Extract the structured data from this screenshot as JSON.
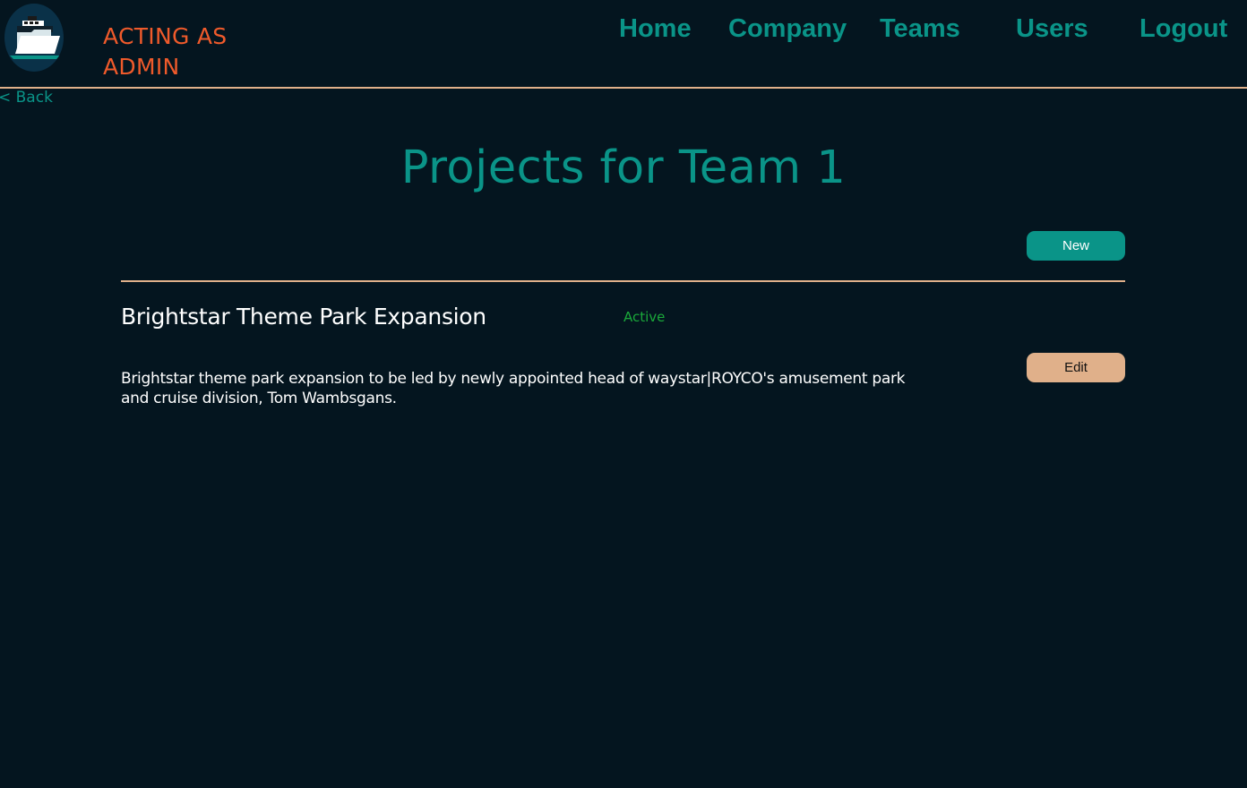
{
  "header": {
    "role_label": "ACTING AS ADMIN",
    "logo_icon": "folder-ship-logo-icon"
  },
  "nav": {
    "home": "Home",
    "company": "Company",
    "teams": "Teams",
    "users": "Users",
    "logout": "Logout"
  },
  "back_link": "< Back",
  "page_title": "Projects for Team 1",
  "new_button": "New",
  "projects": [
    {
      "name": "Brightstar Theme Park Expansion",
      "status": "Active",
      "description": "Brightstar theme park expansion to be led by newly appointed head of waystar|ROYCO's amusement park and cruise division, Tom Wambsgans.",
      "edit_label": "Edit"
    }
  ],
  "colors": {
    "background": "#04151f",
    "accent_teal": "#0a9488",
    "accent_orange": "#ef5a2b",
    "accent_tan": "#e0b08a",
    "status_active": "#1aa93a"
  }
}
